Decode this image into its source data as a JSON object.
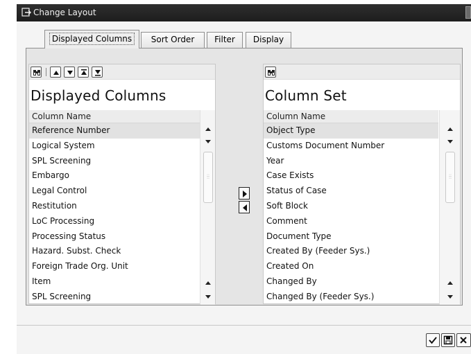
{
  "window": {
    "title": "Change Layout"
  },
  "tabs": [
    {
      "label": "Displayed Columns",
      "active": true
    },
    {
      "label": "Sort Order",
      "active": false
    },
    {
      "label": "Filter",
      "active": false
    },
    {
      "label": "Display",
      "active": false
    }
  ],
  "displayed_columns": {
    "title": "Displayed Columns",
    "header": "Column Name",
    "rows": [
      "Reference Number",
      "Logical System",
      "SPL Screening",
      "Embargo",
      "Legal Control",
      "Restitution",
      "LoC Processing",
      "Processing Status",
      "Hazard. Subst. Check",
      "Foreign Trade Org. Unit",
      "Item",
      "SPL Screening"
    ],
    "selected_row": "Reference Number"
  },
  "column_set": {
    "title": "Column Set",
    "header": "Column Name",
    "rows": [
      "Object Type",
      "Customs Document Number",
      "Year",
      "Case Exists",
      "Status of Case",
      "Soft Block",
      "Comment",
      "Document Type",
      "Created By (Feeder Sys.)",
      "Created On",
      "Changed By",
      "Changed By (Feeder Sys.)"
    ],
    "selected_row": "Object Type"
  },
  "icons": {
    "window_icon": "change-layout-icon",
    "find": "binoculars-icon",
    "move_up": "arrow-up-icon",
    "move_down": "arrow-down-icon",
    "move_top": "arrow-top-icon",
    "move_bottom": "arrow-bottom-icon",
    "add": "arrow-right-icon",
    "remove": "arrow-left-icon",
    "confirm": "checkmark-icon",
    "save": "save-icon",
    "cancel": "cancel-icon"
  }
}
